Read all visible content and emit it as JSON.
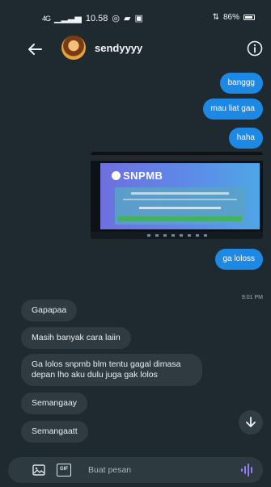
{
  "status_bar": {
    "signal": "4G",
    "clock": "10.58",
    "battery": "86%"
  },
  "header": {
    "contact_name": "sendyyyy"
  },
  "sent_messages": [
    {
      "text": "banggg"
    },
    {
      "text": "mau liat gaa"
    },
    {
      "text": "haha"
    },
    {
      "text": "ga loloss"
    }
  ],
  "image_attachment": {
    "logo_text": "SNPMB"
  },
  "timestamp": "9:01 PM",
  "received_messages": [
    {
      "text": "Gapapaa"
    },
    {
      "text": "Masih banyak cara laiin"
    },
    {
      "text": "Ga lolos snpmb blm tentu gagal dimasa depan lho aku dulu juga gak lolos"
    },
    {
      "text": "Semangaay"
    },
    {
      "text": "Semangaatt"
    }
  ],
  "composer": {
    "placeholder": "Buat pesan",
    "gif_label": "GIF"
  },
  "colors": {
    "background": "#1f2a30",
    "sent_bubble": "#1e88e5",
    "received_bubble": "#2f3b41",
    "voice_icon": "#9b7cf0"
  }
}
